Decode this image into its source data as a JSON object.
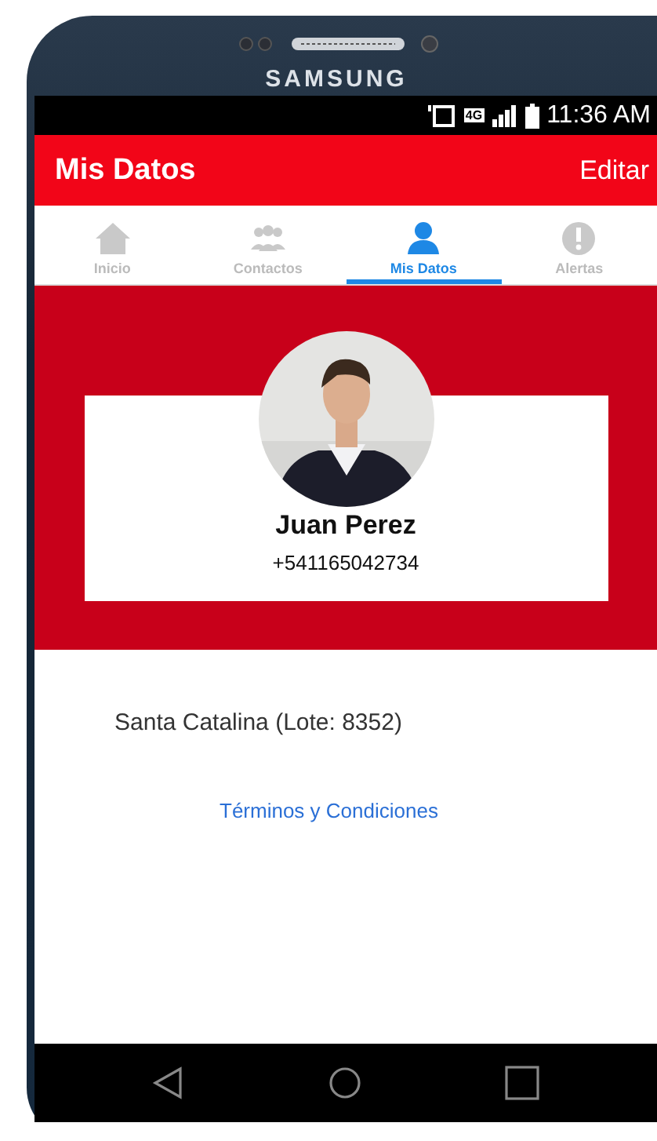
{
  "device": {
    "brand": "SAMSUNG"
  },
  "status_bar": {
    "network": "4G",
    "time": "11:36 AM"
  },
  "app_bar": {
    "title": "Mis Datos",
    "action": "Editar"
  },
  "tabs": [
    {
      "label": "Inicio",
      "selected": false
    },
    {
      "label": "Contactos",
      "selected": false
    },
    {
      "label": "Mis Datos",
      "selected": true
    },
    {
      "label": "Alertas",
      "selected": false
    }
  ],
  "profile": {
    "name": "Juan Perez",
    "phone": "+541165042734"
  },
  "address": "Santa Catalina (Lote: 8352)",
  "link": "Términos y Condiciones"
}
